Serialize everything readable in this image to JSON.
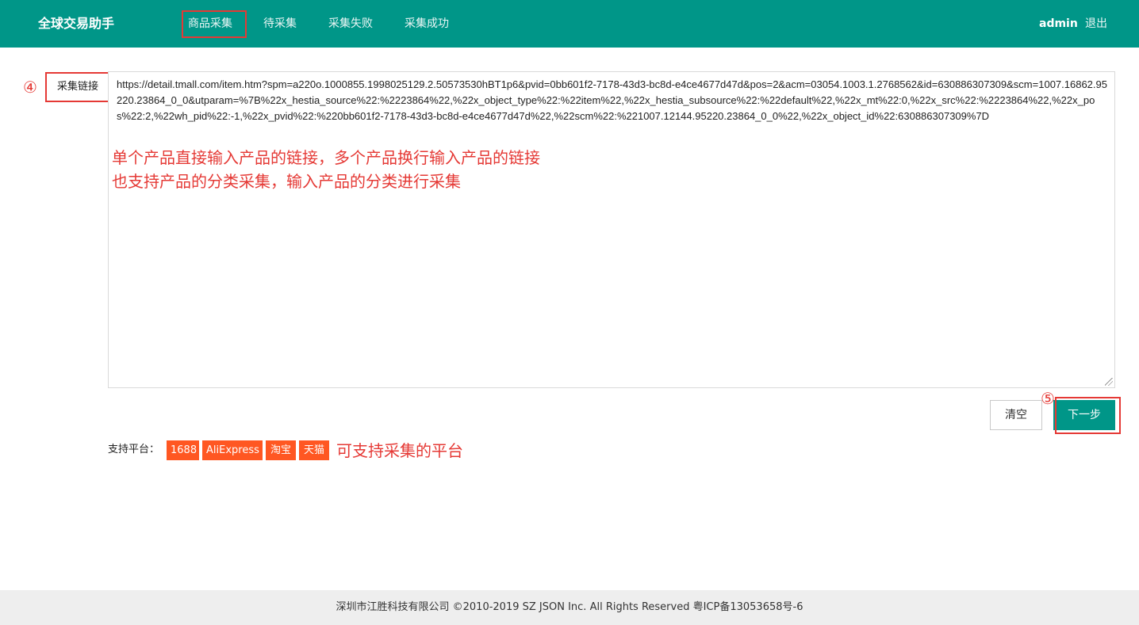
{
  "header": {
    "brand": "全球交易助手",
    "nav": [
      {
        "label": "商品采集",
        "active": true
      },
      {
        "label": "待采集",
        "active": false
      },
      {
        "label": "采集失败",
        "active": false
      },
      {
        "label": "采集成功",
        "active": false
      }
    ],
    "user": "admin",
    "logout": "退出"
  },
  "form": {
    "step_label_marker": "④",
    "field_label": "采集链接",
    "url_value": "https://detail.tmall.com/item.htm?spm=a220o.1000855.1998025129.2.50573530hBT1p6&pvid=0bb601f2-7178-43d3-bc8d-e4ce4677d47d&pos=2&acm=03054.1003.1.2768562&id=630886307309&scm=1007.16862.95220.23864_0_0&utparam=%7B%22x_hestia_source%22:%2223864%22,%22x_object_type%22:%22item%22,%22x_hestia_subsource%22:%22default%22,%22x_mt%22:0,%22x_src%22:%2223864%22,%22x_pos%22:2,%22wh_pid%22:-1,%22x_pvid%22:%220bb601f2-7178-43d3-bc8d-e4ce4677d47d%22,%22scm%22:%221007.12144.95220.23864_0_0%22,%22x_object_id%22:630886307309%7D",
    "hint_line1": "单个产品直接输入产品的链接，多个产品换行输入产品的链接",
    "hint_line2": "也支持产品的分类采集，输入产品的分类进行采集",
    "clear_button": "清空",
    "next_marker": "⑤",
    "next_button": "下一步"
  },
  "platforms": {
    "label": "支持平台：",
    "items": [
      "1688",
      "AliExpress",
      "淘宝",
      "天猫"
    ],
    "hint": "可支持采集的平台",
    "badge_color": "#ff5722"
  },
  "footer": {
    "text": "深圳市江胜科技有限公司 ©2010-2019 SZ JSON Inc. All Rights Reserved 粤ICP备13053658号-6"
  },
  "colors": {
    "primary": "#009688",
    "annotation_red": "#e53935"
  }
}
